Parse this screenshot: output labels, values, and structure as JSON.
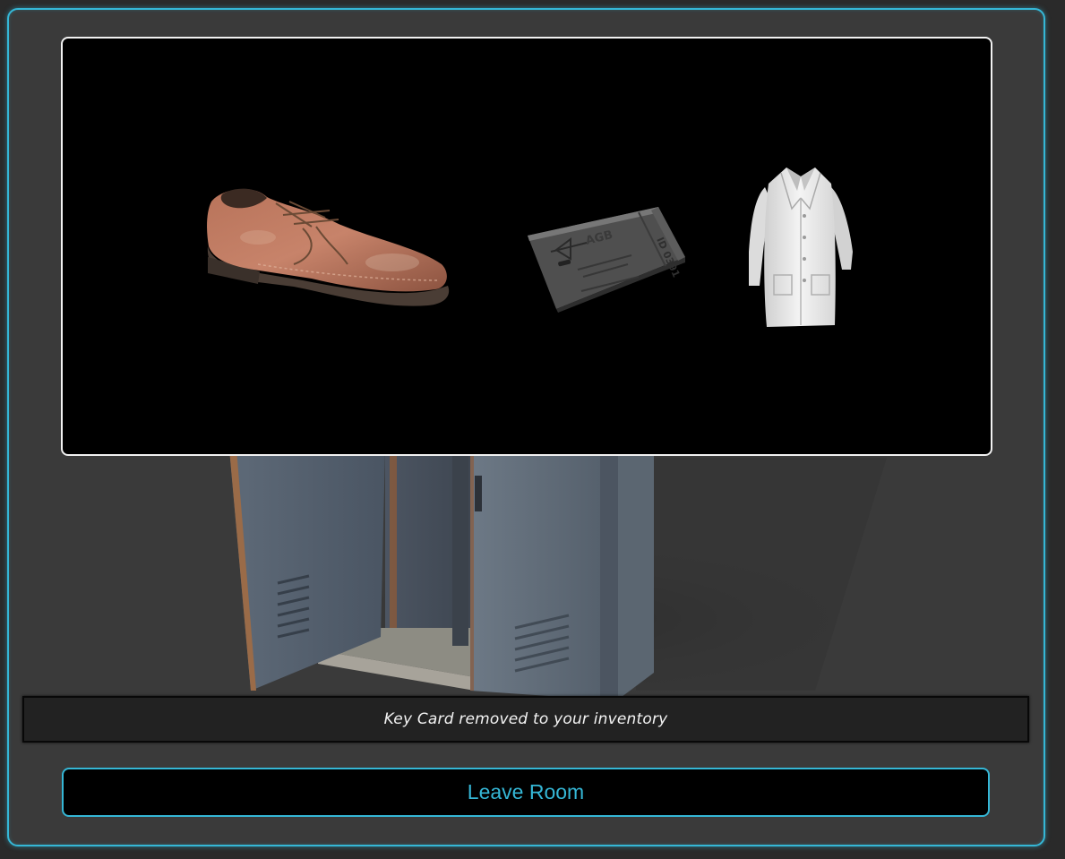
{
  "items": [
    {
      "name": "shoe",
      "icon": "shoe-icon"
    },
    {
      "name": "key card",
      "icon": "key-card-icon",
      "card_logo": "AGB",
      "card_id": "ID 0391"
    },
    {
      "name": "lab coat",
      "icon": "lab-coat-icon"
    }
  ],
  "scene": {
    "icon": "locker-icon"
  },
  "message": "Key Card removed to your inventory",
  "leave_button_label": "Leave Room",
  "colors": {
    "accent": "#35b7d6",
    "panel_bg": "#000000",
    "frame_bg": "#3a3a3a",
    "message_bg": "#222222"
  }
}
